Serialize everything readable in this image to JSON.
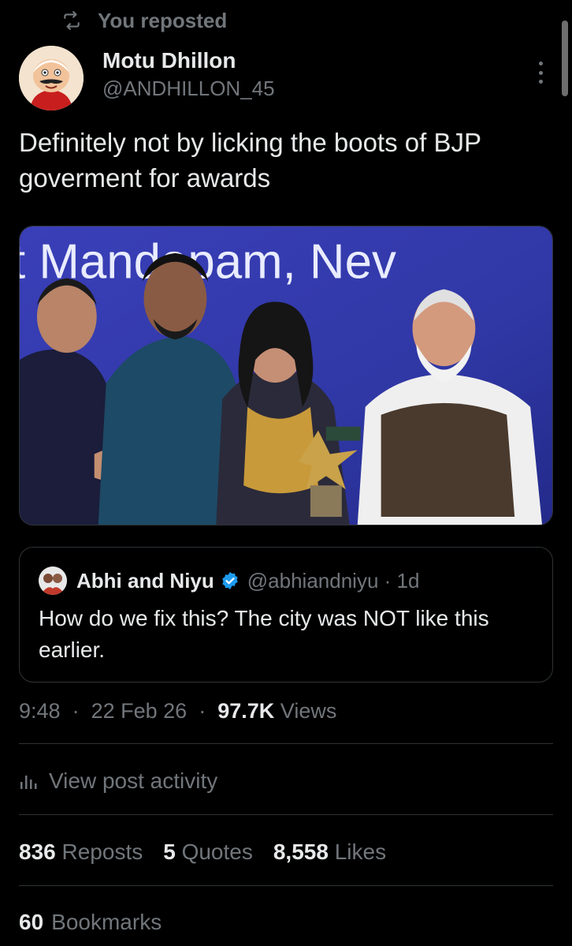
{
  "repost": {
    "label": "You reposted",
    "icon": "repost-icon"
  },
  "post": {
    "author_name": "Motu Dhillon",
    "author_handle": "@ANDHILLON_45",
    "text": "Definitely not by licking the boots of BJP goverment for awards",
    "media_caption": "t Mandapam, Nev"
  },
  "quote": {
    "name": "Abhi and Niyu",
    "handle_time": "@abhiandniyu · 1d",
    "text": "How do we fix this? The city was NOT like this earlier."
  },
  "meta": {
    "time": "9:48",
    "date": "22 Feb 26",
    "views_count": "97.7K",
    "views_label": "Views"
  },
  "activity": {
    "label": "View post activity",
    "icon": "analytics-icon"
  },
  "stats": {
    "reposts_count": "836",
    "reposts_label": "Reposts",
    "quotes_count": "5",
    "quotes_label": "Quotes",
    "likes_count": "8,558",
    "likes_label": "Likes",
    "bookmarks_count": "60",
    "bookmarks_label": "Bookmarks"
  },
  "colors": {
    "background": "#000000",
    "text_primary": "#e7e9ea",
    "text_secondary": "#71767b",
    "border": "#2f3336",
    "verified": "#1d9bf0"
  }
}
